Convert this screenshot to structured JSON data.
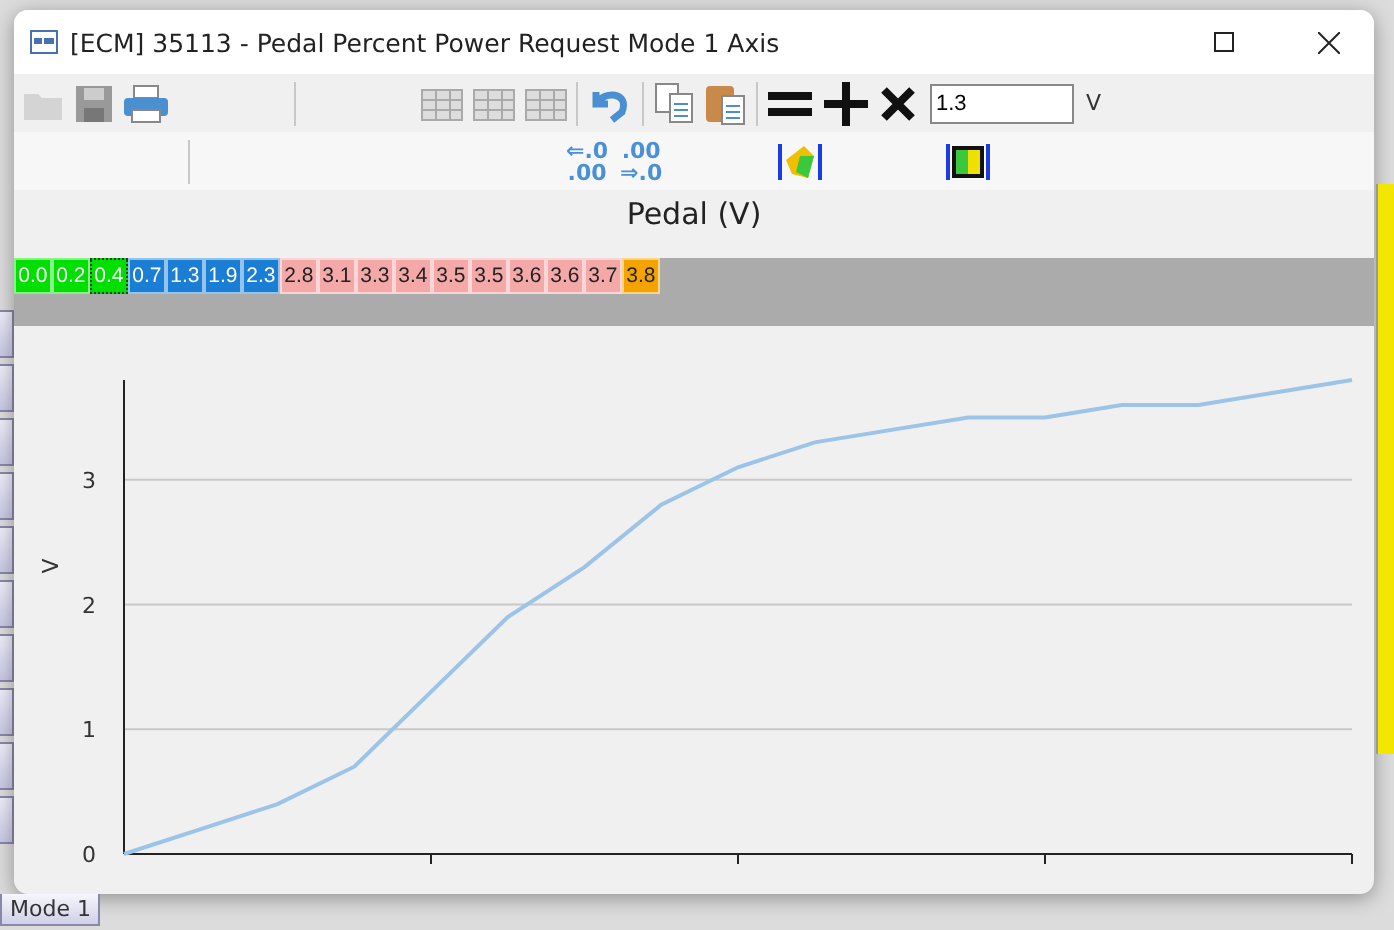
{
  "window": {
    "title": "[ECM] 35113 - Pedal Percent Power Request Mode 1 Axis"
  },
  "toolbar": {
    "value_field": {
      "value": "1.3"
    },
    "unit": "V"
  },
  "decimal_buttons": [
    {
      "lines": [
        "⇐.0",
        ".00"
      ]
    },
    {
      "lines": [
        ".00",
        "⇒.0"
      ]
    }
  ],
  "axis_label": "Pedal (V)",
  "cells": [
    {
      "text": "0.0",
      "color": "#00e000",
      "selected": false
    },
    {
      "text": "0.2",
      "color": "#00e000",
      "selected": false
    },
    {
      "text": "0.4",
      "color": "#00e000",
      "selected": true
    },
    {
      "text": "0.7",
      "color": "#1a7fd4",
      "selected": false
    },
    {
      "text": "1.3",
      "color": "#1a7fd4",
      "selected": false
    },
    {
      "text": "1.9",
      "color": "#1a7fd4",
      "selected": false
    },
    {
      "text": "2.3",
      "color": "#1a7fd4",
      "selected": false
    },
    {
      "text": "2.8",
      "color": "#f5a8a8",
      "selected": false
    },
    {
      "text": "3.1",
      "color": "#f5a8a8",
      "selected": false
    },
    {
      "text": "3.3",
      "color": "#f5a8a8",
      "selected": false
    },
    {
      "text": "3.4",
      "color": "#f5a8a8",
      "selected": false
    },
    {
      "text": "3.5",
      "color": "#f5a8a8",
      "selected": false
    },
    {
      "text": "3.5",
      "color": "#f5a8a8",
      "selected": false
    },
    {
      "text": "3.6",
      "color": "#f5a8a8",
      "selected": false
    },
    {
      "text": "3.6",
      "color": "#f5a8a8",
      "selected": false
    },
    {
      "text": "3.7",
      "color": "#f5a8a8",
      "selected": false
    },
    {
      "text": "3.8",
      "color": "#f5a300",
      "selected": false
    }
  ],
  "chart": {
    "chart_data": {
      "type": "line",
      "ylabel": "V",
      "categories": [
        null,
        null,
        null,
        null,
        null,
        null,
        null,
        null,
        null,
        null,
        null,
        null,
        null,
        null,
        null,
        null,
        null
      ],
      "series": [
        {
          "color": "#9cc3e8",
          "values": [
            0.0,
            0.2,
            0.4,
            0.7,
            1.3,
            1.9,
            2.3,
            2.8,
            3.1,
            3.3,
            3.4,
            3.5,
            3.5,
            3.6,
            3.6,
            3.7,
            3.8
          ]
        }
      ],
      "grid": true,
      "ylim": [
        0,
        3.8
      ],
      "yticks": [
        0,
        1,
        2,
        3
      ]
    }
  },
  "background_tab": {
    "label": "Mode 1"
  }
}
